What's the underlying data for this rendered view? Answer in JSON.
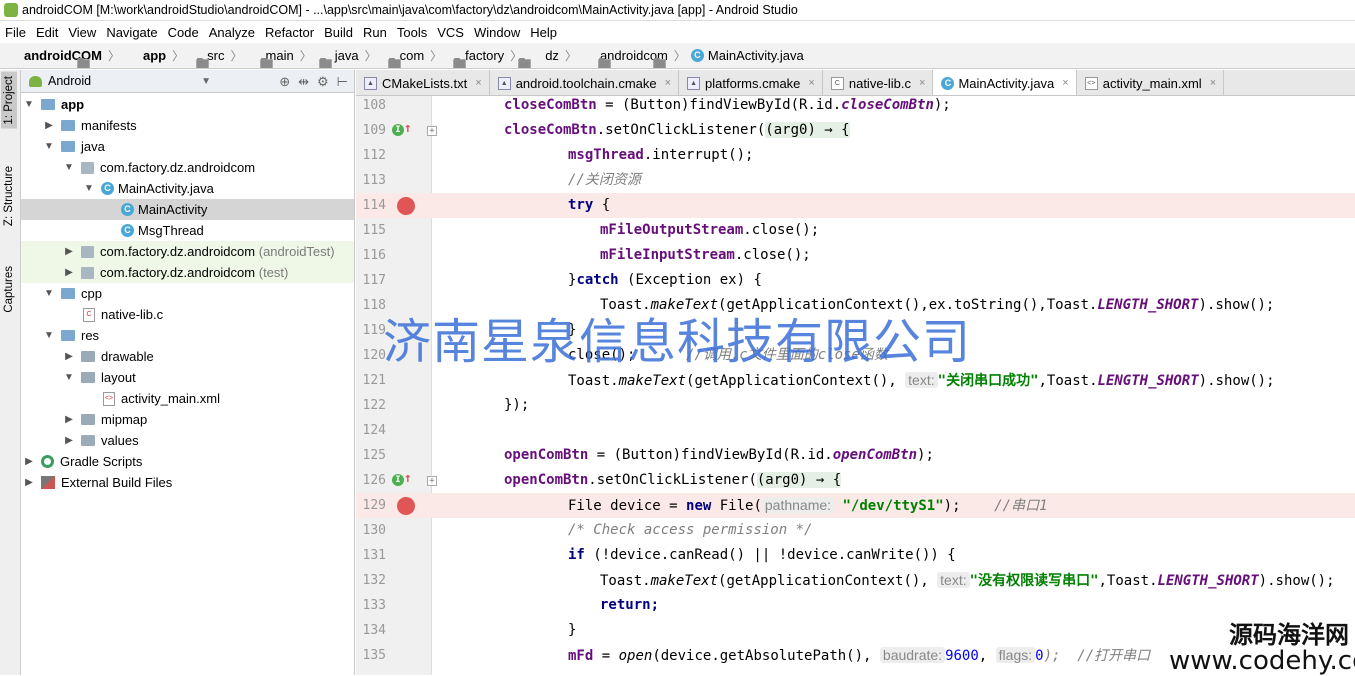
{
  "window": {
    "title": "androidCOM [M:\\work\\androidStudio\\androidCOM] - ...\\app\\src\\main\\java\\com\\factory\\dz\\androidcom\\MainActivity.java [app] - Android Studio"
  },
  "menu": [
    "File",
    "Edit",
    "View",
    "Navigate",
    "Code",
    "Analyze",
    "Refactor",
    "Build",
    "Run",
    "Tools",
    "VCS",
    "Window",
    "Help"
  ],
  "breadcrumb": [
    "androidCOM",
    "app",
    "src",
    "main",
    "java",
    "com",
    "factory",
    "dz",
    "androidcom",
    "MainActivity.java"
  ],
  "side_tabs": {
    "project": "1: Project",
    "structure": "Z: Structure",
    "captures": "Captures"
  },
  "project": {
    "view": "Android",
    "tree": [
      {
        "label": "app",
        "hint": ""
      },
      {
        "label": "manifests",
        "hint": ""
      },
      {
        "label": "java",
        "hint": ""
      },
      {
        "label": "com.factory.dz.androidcom",
        "hint": ""
      },
      {
        "label": "MainActivity.java",
        "hint": ""
      },
      {
        "label": "MainActivity",
        "hint": ""
      },
      {
        "label": "MsgThread",
        "hint": ""
      },
      {
        "label": "com.factory.dz.androidcom",
        "hint": "(androidTest)"
      },
      {
        "label": "com.factory.dz.androidcom",
        "hint": "(test)"
      },
      {
        "label": "cpp",
        "hint": ""
      },
      {
        "label": "native-lib.c",
        "hint": ""
      },
      {
        "label": "res",
        "hint": ""
      },
      {
        "label": "drawable",
        "hint": ""
      },
      {
        "label": "layout",
        "hint": ""
      },
      {
        "label": "activity_main.xml",
        "hint": ""
      },
      {
        "label": "mipmap",
        "hint": ""
      },
      {
        "label": "values",
        "hint": ""
      },
      {
        "label": "Gradle Scripts",
        "hint": ""
      },
      {
        "label": "External Build Files",
        "hint": ""
      }
    ]
  },
  "tabs": [
    "CMakeLists.txt",
    "android.toolchain.cmake",
    "platforms.cmake",
    "native-lib.c",
    "MainActivity.java",
    "activity_main.xml"
  ],
  "line_numbers": [
    "108",
    "109",
    "112",
    "113",
    "114",
    "115",
    "116",
    "117",
    "118",
    "119",
    "120",
    "121",
    "122",
    "124",
    "125",
    "126",
    "129",
    "130",
    "131",
    "132",
    "133",
    "134",
    "135"
  ],
  "code_text": {
    "l108a": "closeComBtn",
    "l108b": " = (Button)findViewById(R.id.",
    "l108c": "closeComBtn",
    "l108d": ");",
    "l109a": "closeComBtn",
    ".l109b": "",
    "l109b": ".setOnClickListener(",
    "l109c": "(arg0) → {",
    "l112a": "msgThread",
    "l112b": ".interrupt();",
    "l113": "//关闭资源",
    "l114a": "try",
    "l114b": " {",
    "l115a": "mFileOutputStream",
    "l115b": ".close();",
    "l116a": "mFileInputStream",
    "l116b": ".close();",
    "l117a": "}",
    "l117b": "catch",
    "l117c": " (Exception ex) {",
    "l118a": "Toast.",
    "l118b": "makeText",
    "l118c": "(getApplicationContext(),ex.toString(),Toast.",
    "l118d": "LENGTH_SHORT",
    "l118e": ").show();",
    "l119": "}",
    "l120a": "close();",
    "l120b": "      //调用.c文件里面的close函数",
    "l121a": "Toast.",
    "l121b": "makeText",
    "l121c": "(getApplicationContext(),",
    "l121h": "text:",
    "l121d": "\"关闭串口成功\"",
    "l121e": ",Toast.",
    "l121f": "LENGTH_SHORT",
    "l121g": ").show();",
    "l122": "});",
    "l125a": "openComBtn",
    "l125b": " = (Button)findViewById(R.id.",
    "l125c": "openComBtn",
    "l125d": ");",
    "l126a": "openComBtn",
    "l126b": ".setOnClickListener(",
    "l126c": "(arg0) → {",
    "l129a": "File device = ",
    "l129b": "new",
    "l129c": " File(",
    "l129h": "pathname:",
    "l129d": "\"/dev/ttyS1\"",
    "l129e": ");",
    "l129f": "    //串口1",
    "l130": "/* Check access permission */",
    "l131a": "if",
    "l131b": " (!device.canRead() || !device.canWrite()) {",
    "l132a": "Toast.",
    "l132b": "makeText",
    "l132c": "(getApplicationContext(),",
    "l132h": "text:",
    "l132d": "\"没有权限读写串口\"",
    "l132e": ",Toast.",
    "l132f": "LENGTH_SHORT",
    "l132g": ").show();",
    "l133": "return;",
    "l134": "}",
    "l135a": "mFd",
    "l135b": " = ",
    "l135c": "open",
    "l135d": "(device.getAbsolutePath(),",
    "l135h1": "baudrate:",
    "l135e": "9600",
    "l135f": ",",
    "l135h2": "flags:",
    "l135g": "0",
    "l135i": ");  //打开串口"
  },
  "watermark": {
    "main": "济南星泉信息科技有限公司",
    "corner_cn": "源码海洋网",
    "corner_en": "www.codehy.com"
  },
  "colors": {
    "keyword": "#000080",
    "field": "#660e7a",
    "string": "#008000",
    "comment": "#808080",
    "number": "#0000ff",
    "breakpoint": "#e05555"
  }
}
